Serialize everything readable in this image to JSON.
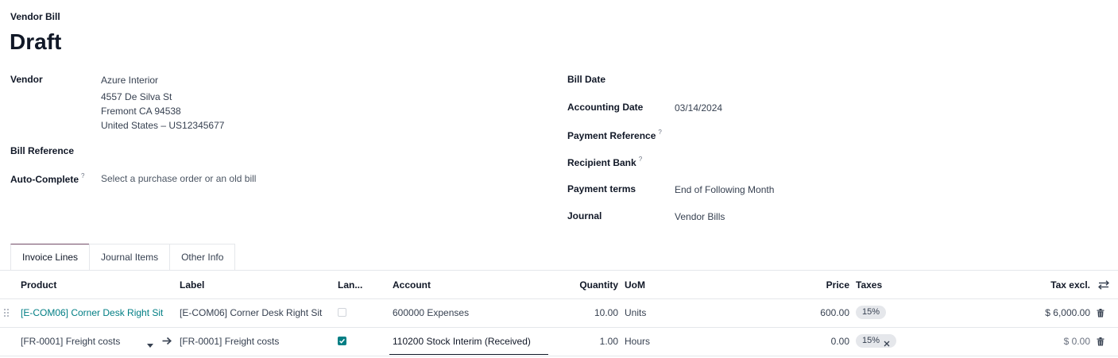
{
  "header": {
    "doc_type": "Vendor Bill",
    "status": "Draft"
  },
  "left_fields": {
    "vendor_label": "Vendor",
    "vendor_lines": [
      "Azure Interior",
      "4557 De Silva St",
      "Fremont CA 94538",
      "United States – US12345677"
    ],
    "bill_reference_label": "Bill Reference",
    "auto_complete_label": "Auto-Complete",
    "auto_complete_placeholder": "Select a purchase order or an old bill",
    "help_mark": "?"
  },
  "right_fields": {
    "bill_date_label": "Bill Date",
    "accounting_date_label": "Accounting Date",
    "accounting_date_value": "03/14/2024",
    "payment_reference_label": "Payment Reference",
    "recipient_bank_label": "Recipient Bank",
    "payment_terms_label": "Payment terms",
    "payment_terms_value": "End of Following Month",
    "journal_label": "Journal",
    "journal_value": "Vendor Bills"
  },
  "tabs": [
    {
      "label": "Invoice Lines",
      "active": true
    },
    {
      "label": "Journal Items",
      "active": false
    },
    {
      "label": "Other Info",
      "active": false
    }
  ],
  "table": {
    "columns": {
      "product": "Product",
      "label": "Label",
      "landed": "Lan...",
      "account": "Account",
      "quantity": "Quantity",
      "uom": "UoM",
      "price": "Price",
      "taxes": "Taxes",
      "tax_excl": "Tax excl."
    },
    "rows": [
      {
        "product": "[E-COM06] Corner Desk Right Sit",
        "label": "[E-COM06] Corner Desk Right Sit",
        "landed": false,
        "account": "600000 Expenses",
        "quantity": "10.00",
        "uom": "Units",
        "price": "600.00",
        "tax": "15%",
        "subtotal": "$ 6,000.00"
      },
      {
        "product": "[FR-0001] Freight costs",
        "label": "[FR-0001] Freight costs",
        "landed": true,
        "account": "110200 Stock Interim (Received)",
        "quantity": "1.00",
        "uom": "Hours",
        "price": "0.00",
        "tax": "15%",
        "subtotal": "$ 0.00"
      }
    ]
  },
  "colors": {
    "accent": "#017e84",
    "brand": "#714b67"
  }
}
